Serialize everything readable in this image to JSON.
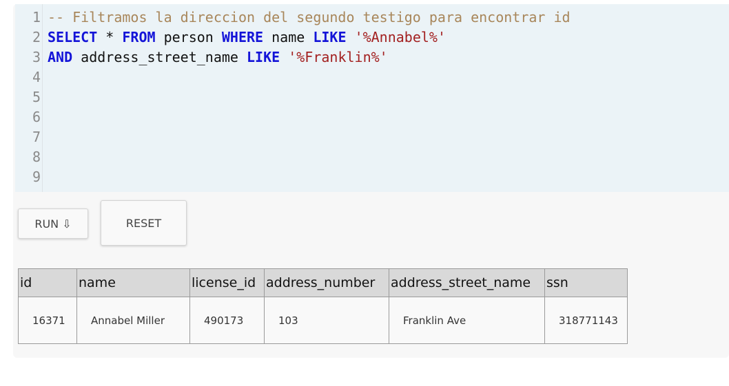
{
  "editor": {
    "lines": [
      {
        "n": "1",
        "tokens": [
          {
            "t": "-- Filtramos la direccion del segundo testigo para encontrar id",
            "c": "comment"
          }
        ]
      },
      {
        "n": "2",
        "tokens": [
          {
            "t": "SELECT",
            "c": "kw"
          },
          {
            "t": " * ",
            "c": ""
          },
          {
            "t": "FROM",
            "c": "kw"
          },
          {
            "t": " person ",
            "c": ""
          },
          {
            "t": "WHERE",
            "c": "kw"
          },
          {
            "t": " name ",
            "c": ""
          },
          {
            "t": "LIKE",
            "c": "kw"
          },
          {
            "t": " ",
            "c": ""
          },
          {
            "t": "'%Annabel%'",
            "c": "str"
          }
        ]
      },
      {
        "n": "3",
        "tokens": [
          {
            "t": "AND",
            "c": "kw"
          },
          {
            "t": " address_street_name ",
            "c": ""
          },
          {
            "t": "LIKE",
            "c": "kw"
          },
          {
            "t": " ",
            "c": ""
          },
          {
            "t": "'%Franklin%'",
            "c": "str"
          }
        ]
      },
      {
        "n": "4",
        "tokens": []
      },
      {
        "n": "5",
        "tokens": []
      },
      {
        "n": "6",
        "tokens": []
      },
      {
        "n": "7",
        "tokens": []
      },
      {
        "n": "8",
        "tokens": []
      },
      {
        "n": "9",
        "tokens": []
      }
    ]
  },
  "buttons": {
    "run_label": "RUN ⇩",
    "reset_label": "RESET"
  },
  "results": {
    "columns": [
      "id",
      "name",
      "license_id",
      "address_number",
      "address_street_name",
      "ssn"
    ],
    "rows": [
      [
        "16371",
        "Annabel Miller",
        "490173",
        "103",
        "Franklin Ave",
        "318771143"
      ]
    ]
  },
  "colors": {
    "keyword": "#1414d8",
    "string": "#a32121",
    "comment": "#a8865a",
    "editor_bg": "#ebf3f7"
  }
}
